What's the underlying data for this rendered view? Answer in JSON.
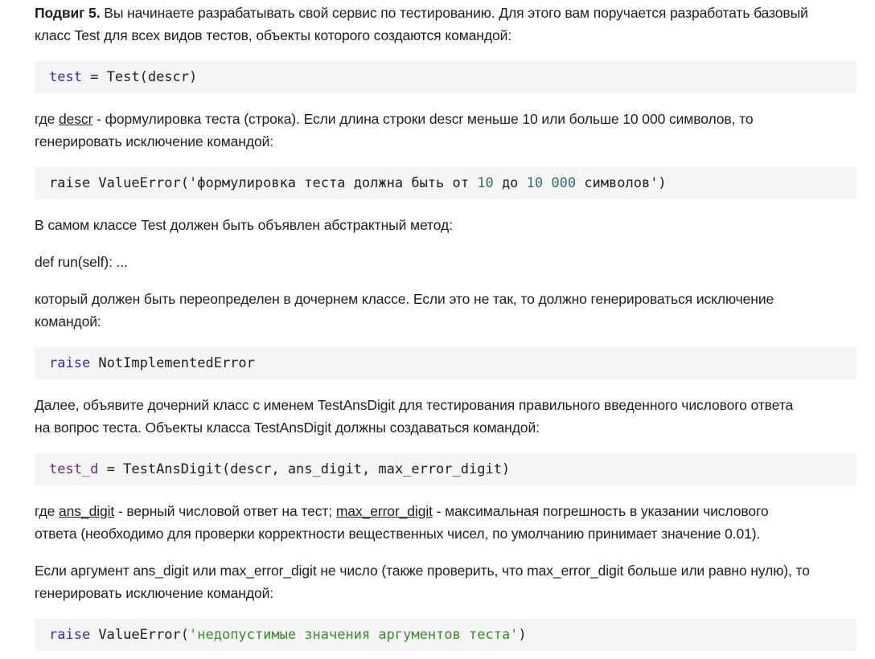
{
  "intro": {
    "title": "Подвиг 5.",
    "text_line1": " Вы начинаете разрабатывать свой сервис по тестированию. Для этого вам поручается разработать базовый",
    "text_line2": "класс Test для всех видов тестов, объекты которого создаются командой:"
  },
  "code1": {
    "var": "test",
    "rest": " = Test(descr)"
  },
  "p_descr": {
    "prefix": "где ",
    "term": "descr",
    "line1_rest": " - формулировка теста (строка). Если длина строки descr меньше 10 или больше 10 000 символов, то",
    "line2": "генерировать исключение командой:"
  },
  "code2": {
    "a": "raise ValueError('формулировка теста должна быть от ",
    "n1": "10",
    "b": " до ",
    "n2": "10 000",
    "c": " символов')"
  },
  "p_abstract": "В самом классе Test должен быть объявлен абстрактный метод:",
  "p_def": "def run(self): ...",
  "p_override": {
    "line1": "который должен быть переопределен в дочернем классе. Если это не так, то должно генерироваться исключение",
    "line2": "командой:"
  },
  "code3": {
    "kw": "raise",
    "rest": " NotImplementedError"
  },
  "p_child": {
    "line1": "Далее, объявите дочерний класс с именем TestAnsDigit для тестирования правильного введенного числового ответа",
    "line2": "на вопрос теста. Объекты класса TestAnsDigit должны создаваться командой:"
  },
  "code4": {
    "var": "test_d",
    "rest": " = TestAnsDigit(descr, ans_digit, max_error_digit)"
  },
  "p_args": {
    "prefix": "где ",
    "term1": "ans_digit",
    "mid": " - верный числовой ответ на тест; ",
    "term2": "max_error_digit",
    "line1_rest": " - максимальная погрешность в указании числового",
    "line2": "ответа (необходимо для проверки корректности вещественных чисел, по умолчанию принимает значение 0.01)."
  },
  "p_check": {
    "line1": "Если аргумент ans_digit или max_error_digit не число (также проверить, что max_error_digit больше или равно нулю), то",
    "line2": "генерировать исключение командой:"
  },
  "code5": {
    "kw": "raise",
    "a": " ValueError(",
    "str": "'недопустимые значения аргументов теста'",
    "b": ")"
  }
}
